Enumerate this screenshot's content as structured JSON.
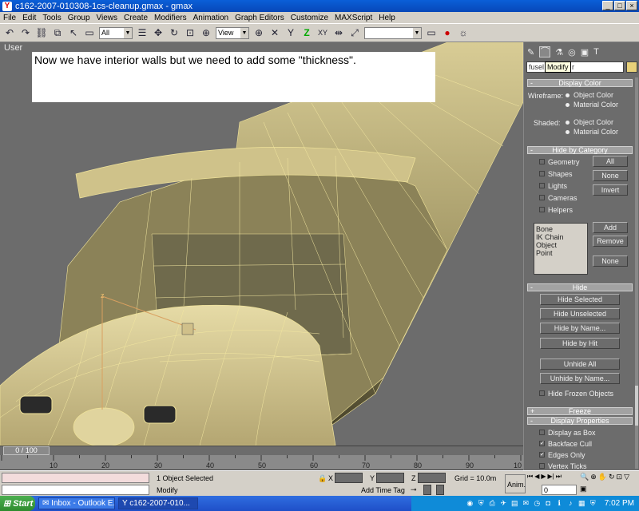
{
  "window": {
    "app_glyph": "Y",
    "title": "c162-2007-010308-1cs-cleanup.gmax - gmax",
    "min": "_",
    "max": "□",
    "close": "×"
  },
  "menu": [
    "File",
    "Edit",
    "Tools",
    "Group",
    "Views",
    "Create",
    "Modifiers",
    "Animation",
    "Graph Editors",
    "Customize",
    "MAXScript",
    "Help"
  ],
  "toolbar": {
    "selection_filter": "All",
    "reference_coord": "View",
    "axis_z": "Z",
    "axis_xy": "XY",
    "icons": {
      "undo": "↶",
      "redo": "↷",
      "link": "⛓",
      "unlink": "⧉",
      "select": "↖",
      "region": "▭",
      "select_by_name": "☰",
      "move": "✥",
      "rotate": "↻",
      "scale": "⊡",
      "pivot": "⊕",
      "snap_x": "✕",
      "snap_y": "Y",
      "mirror": "⇹",
      "align": "⤢",
      "teapot": "●",
      "render": "☼"
    }
  },
  "viewport": {
    "label": "User",
    "caption": "Now we have interior walls but we need to add some \"thickness\".",
    "axis_z": "z"
  },
  "command_panel": {
    "tabs": [
      "✎",
      "⌒",
      "⚗",
      "◎",
      "▣",
      "T"
    ],
    "object_name": "fusel",
    "object_name_tail": "r",
    "tooltip": "Modify",
    "display_color": {
      "title": "Display Color",
      "wireframe_label": "Wireframe:",
      "shaded_label": "Shaded:",
      "option_object": "Object Color",
      "option_material": "Material Color"
    },
    "hide_by_category": {
      "title": "Hide by Category",
      "items": [
        "Geometry",
        "Shapes",
        "Lights",
        "Cameras",
        "Helpers"
      ],
      "buttons": [
        "All",
        "None",
        "Invert"
      ],
      "list": [
        "Bone",
        "IK Chain Object",
        "Point"
      ],
      "list_buttons": [
        "Add",
        "Remove",
        "None"
      ]
    },
    "hide": {
      "title": "Hide",
      "buttons": [
        "Hide Selected",
        "Hide Unselected",
        "Hide by Name...",
        "Hide by Hit",
        "Unhide All",
        "Unhide by Name..."
      ],
      "checkbox": "Hide Frozen Objects"
    },
    "freeze": {
      "title": "Freeze",
      "marker": "+"
    },
    "display_properties": {
      "title": "Display Properties",
      "marker": "-",
      "items": [
        {
          "label": "Display as Box",
          "checked": false
        },
        {
          "label": "Backface Cull",
          "checked": true
        },
        {
          "label": "Edges Only",
          "checked": true
        },
        {
          "label": "Vertex Ticks",
          "checked": false
        }
      ]
    }
  },
  "timeline": {
    "slider_label": "0 / 100",
    "ticks": [
      "10",
      "20",
      "30",
      "40",
      "50",
      "60",
      "70",
      "80",
      "90",
      "10"
    ]
  },
  "status": {
    "selection": "1 Object Selected",
    "prompt": "Modify",
    "x_label": "X",
    "y_label": "Y",
    "z_label": "Z",
    "grid": "Grid = 10.0m",
    "add_time_tag": "Add Time Tag",
    "anim": "Anim.",
    "frame": "0"
  },
  "taskbar": {
    "start": "Start",
    "tasks": [
      {
        "label": "Inbox - Outlook E..."
      },
      {
        "label": "c162-2007-010..."
      }
    ],
    "clock": "7:02 PM"
  },
  "colors": {
    "viewport_bg": "#6c6c6c",
    "model_fill": "#bfb482",
    "model_wire": "#f0e39a",
    "ui_gray": "#d4d0c8"
  }
}
